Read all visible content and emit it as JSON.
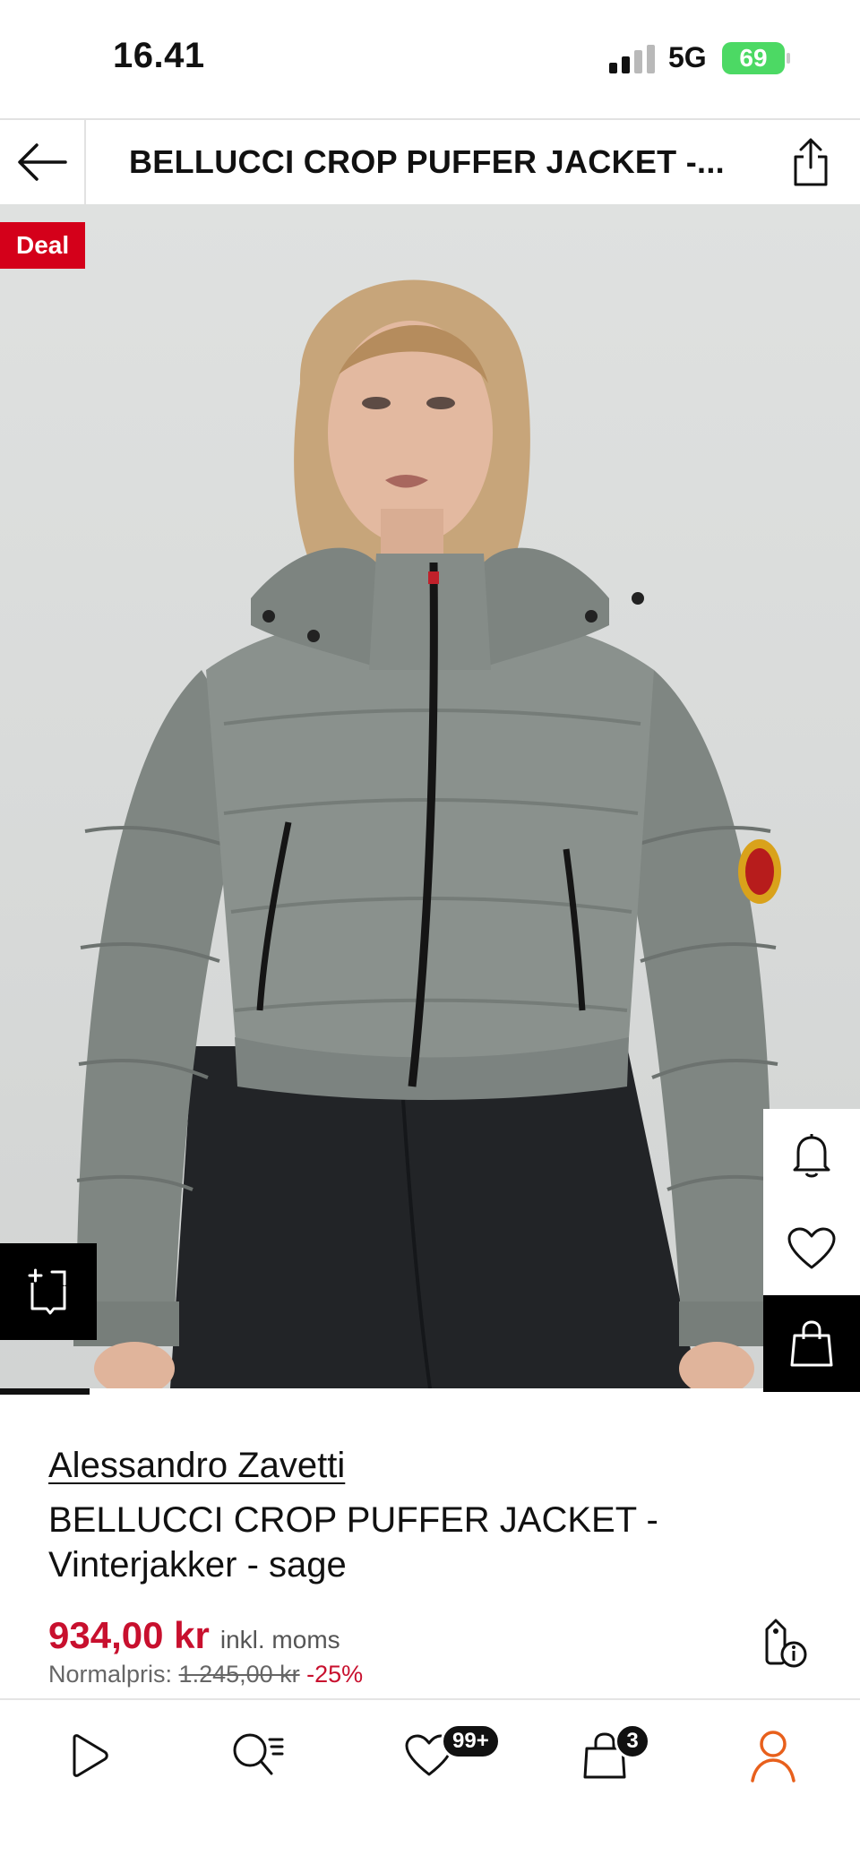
{
  "status_bar": {
    "time": "16.41",
    "network": "5G",
    "battery": "69"
  },
  "header": {
    "title": "BELLUCCI CROP PUFFER JACKET -..."
  },
  "image": {
    "badge": "Deal",
    "icons": {
      "compare": "compare-icon",
      "notify": "bell-icon",
      "wishlist": "heart-icon",
      "cart": "bag-icon"
    }
  },
  "product": {
    "brand": "Alessandro Zavetti",
    "name": "BELLUCCI CROP PUFFER JACKET - Vinterjakker - sage",
    "price": "934,00 kr",
    "vat_note": "inkl. moms",
    "normal_label": "Normalpris:",
    "normal_price": "1.245,00 kr",
    "discount": "-25%"
  },
  "bottom_nav": {
    "wishlist_badge": "99+",
    "cart_badge": "3",
    "active_color": "#e8601c"
  },
  "colors": {
    "accent_red": "#c8102e",
    "deal_red": "#d4001a",
    "jacket_sage": "#8a918d"
  }
}
